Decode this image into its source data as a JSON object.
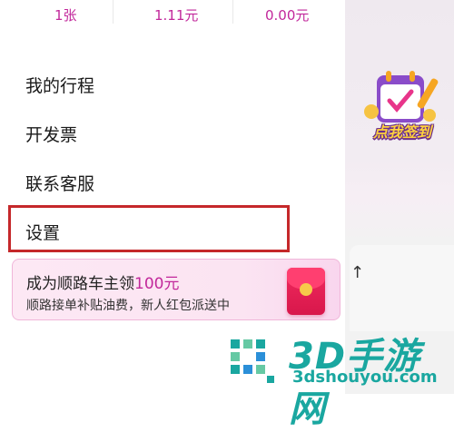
{
  "stats": [
    {
      "value": "1张"
    },
    {
      "value": "1.11元"
    },
    {
      "value": "0.00元"
    }
  ],
  "menu": {
    "items": [
      {
        "label": "我的行程"
      },
      {
        "label": "开发票"
      },
      {
        "label": "联系客服"
      },
      {
        "label": "设置"
      }
    ]
  },
  "promo": {
    "title": "成为顺路车主领",
    "amount": "100元",
    "subtitle": "顺路接单补贴油费，新人红包派送中"
  },
  "checkin": {
    "label": "点我签到"
  },
  "watermark": {
    "title": "3D手游网",
    "url": "3dshouyou.com"
  },
  "colors": {
    "accent": "#c2289b",
    "highlight": "#c5282a",
    "watermark": "#1aa7a0"
  }
}
